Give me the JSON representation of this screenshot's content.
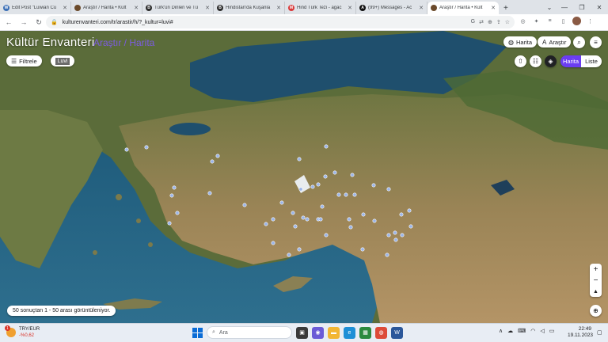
{
  "browser": {
    "tabs": [
      {
        "label": "Edit Post \"Luwian Cu",
        "favicon_color": "#3b6fb6",
        "favicon_letter": "W",
        "active": false
      },
      {
        "label": "Araştır / Harita • Kült",
        "favicon_color": "#6b4a2b",
        "favicon_letter": "",
        "active": false
      },
      {
        "label": "Türk'ün Dinleri ve Tü",
        "favicon_color": "#2b2b2b",
        "favicon_letter": "B",
        "active": false
      },
      {
        "label": "Hindistan'da Kuşanla",
        "favicon_color": "#2b2b2b",
        "favicon_letter": "B",
        "active": false
      },
      {
        "label": "Hind Türk Tezi - agac",
        "favicon_color": "#d93a3a",
        "favicon_letter": "M",
        "active": false
      },
      {
        "label": "(99+) Messages - Ac",
        "favicon_color": "#111111",
        "favicon_letter": "A",
        "active": false
      },
      {
        "label": "Araştır / Harita • Kült",
        "favicon_color": "#6b4a2b",
        "favicon_letter": "",
        "active": true
      }
    ],
    "url": "kulturenvanteri.com/tr/arastir/h/?_kultur=luvi#"
  },
  "app": {
    "brand": "Kültür Envanteri",
    "breadcrumb": "Araştır / Harita",
    "filter_label": "Filtrele",
    "tag_label": "Luvi",
    "map_button": "Harita",
    "search_button": "Araştır",
    "view_toggle": {
      "on": "Harita",
      "off": "Liste"
    },
    "result_text": "50 sonuçtan 1 - 50 arası görüntüleniyor."
  },
  "taskbar": {
    "weather_title": "TRY/EUR",
    "weather_value": "-%0,62",
    "weather_badge": "1",
    "search_placeholder": "Ara",
    "time": "22:49",
    "date": "19.11.2023"
  },
  "colors": {
    "accent": "#6b3df2",
    "marker": "#9ab4e8"
  }
}
